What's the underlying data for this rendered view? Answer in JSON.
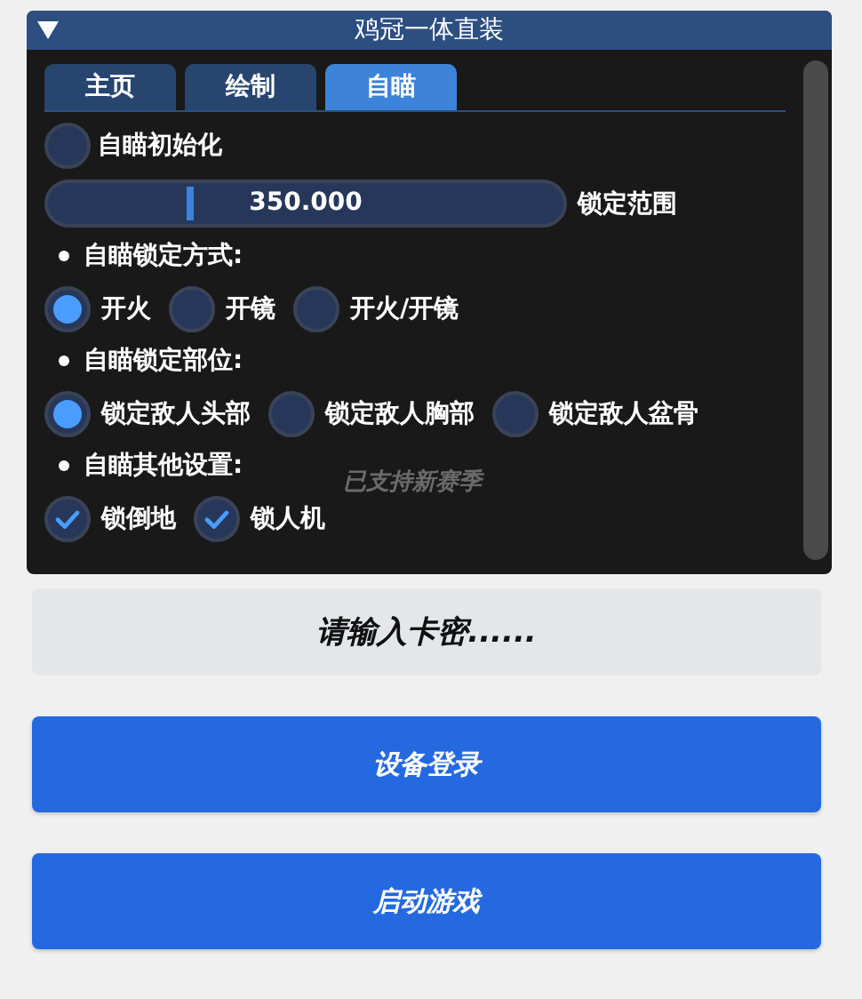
{
  "window": {
    "title": "鸡冠一体直装",
    "tabs": [
      {
        "label": "主页",
        "selected": false
      },
      {
        "label": "绘制",
        "selected": false
      },
      {
        "label": "自瞄",
        "selected": true
      }
    ],
    "items": [
      {
        "kind": "toggle",
        "label": "自瞄初始化",
        "on": false
      },
      {
        "kind": "slider",
        "reading": "350.000",
        "level": 0.27,
        "label": "锁定范围"
      },
      {
        "kind": "bullet",
        "label": "自瞄锁定方式:"
      },
      {
        "kind": "radios",
        "options": [
          {
            "label": "开火",
            "selected": true
          },
          {
            "label": "开镜",
            "selected": false
          },
          {
            "label": "开火/开镜",
            "selected": false
          }
        ]
      },
      {
        "kind": "bullet",
        "label": "自瞄锁定部位:"
      },
      {
        "kind": "radios",
        "options": [
          {
            "label": "锁定敌人头部",
            "selected": true
          },
          {
            "label": "锁定敌人胸部",
            "selected": false
          },
          {
            "label": "锁定敌人盆骨",
            "selected": false
          }
        ]
      },
      {
        "kind": "bullet",
        "label": "自瞄其他设置:"
      },
      {
        "kind": "checks",
        "options": [
          {
            "label": "锁倒地",
            "checked": true
          },
          {
            "label": "锁人机",
            "checked": true
          }
        ]
      }
    ],
    "background_text": "已支持新赛季"
  },
  "key_field": {
    "placeholder": "请输入卡密......"
  },
  "buttons": [
    "设备登录",
    "启动游戏"
  ]
}
